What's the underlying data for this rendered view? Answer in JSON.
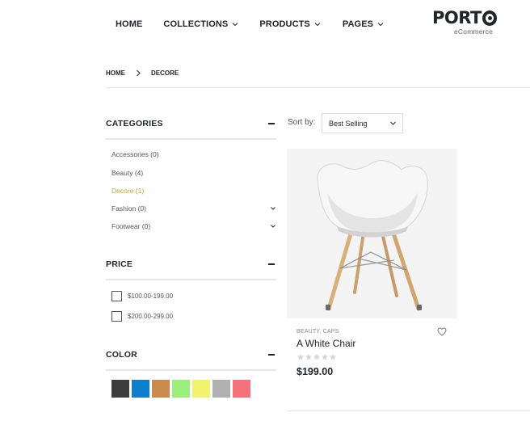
{
  "nav": {
    "home": "HOME",
    "collections": "COLLECTIONS",
    "products": "PRODUCTS",
    "pages": "PAGES"
  },
  "logo": {
    "word": "PORT",
    "tagline": "eCommerce"
  },
  "breadcrumb": {
    "home": "HOME",
    "current": "DECORE"
  },
  "sidebar": {
    "categories": {
      "title": "CATEGORIES",
      "items": [
        {
          "label": "Accessories (0)",
          "expandable": false,
          "active": false
        },
        {
          "label": "Beauty (4)",
          "expandable": false,
          "active": false
        },
        {
          "label": "Decore (1)",
          "expandable": false,
          "active": true
        },
        {
          "label": "Fashion (0)",
          "expandable": true,
          "active": false
        },
        {
          "label": "Footwear (0)",
          "expandable": true,
          "active": false
        }
      ]
    },
    "price": {
      "title": "PRICE",
      "options": [
        "$100.00-199.00",
        "$200.00-299.00"
      ]
    },
    "color": {
      "title": "COLOR",
      "swatches": [
        "#3d3d3d",
        "#0e7fcc",
        "#c98a4b",
        "#9bef7a",
        "#f2f36c",
        "#b0b0b0",
        "#f4727c"
      ]
    }
  },
  "toolbar": {
    "sort_label": "Sort by:",
    "sort_value": "Best Selling"
  },
  "product": {
    "categories": "BEAUTY, CAPS",
    "name": "A White Chair",
    "price": "$199.00",
    "rating": 0,
    "image": "white-chair"
  },
  "colors": {
    "text": "#222529",
    "active_accent": "#c5a32c",
    "muted": "#888888"
  }
}
